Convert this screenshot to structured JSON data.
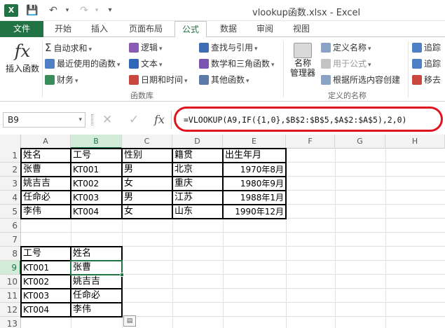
{
  "window": {
    "title": "vlookup函数.xlsx - Excel",
    "app_icon": "X",
    "qat": {
      "save": "💾",
      "undo": "↶",
      "redo": "↷",
      "customize": "▾"
    }
  },
  "tabs": [
    "文件",
    "开始",
    "插入",
    "页面布局",
    "公式",
    "数据",
    "审阅",
    "视图"
  ],
  "active_tab": "公式",
  "ribbon": {
    "insert_function": {
      "icon": "fx",
      "label": "插入函数"
    },
    "autosum": "自动求和",
    "recent": "最近使用的函数",
    "financial": "财务",
    "logical": "逻辑",
    "text": "文本",
    "datetime": "日期和时间",
    "lookup": "查找与引用",
    "math": "数学和三角函数",
    "more": "其他函数",
    "library_group": "函数库",
    "name_manager_top": "名称",
    "name_manager_bottom": "管理器",
    "define_name": "定义名称",
    "use_in_formula": "用于公式",
    "create_from_selection": "根据所选内容创建",
    "defined_names_group": "定义的名称",
    "trace_precedents": "追踪",
    "trace_dependents": "追踪",
    "remove_arrows": "移去"
  },
  "formula_bar": {
    "name_box": "B9",
    "cancel": "✕",
    "enter": "✓",
    "fx": "fx",
    "formula": "=VLOOKUP(A9,IF({1,0},$B$2:$B$5,$A$2:$A$5),2,0)"
  },
  "columns": [
    "A",
    "B",
    "C",
    "D",
    "E",
    "F",
    "G",
    "H"
  ],
  "rows": [
    "1",
    "2",
    "3",
    "4",
    "5",
    "6",
    "7",
    "8",
    "9",
    "10",
    "11",
    "12",
    "13"
  ],
  "active_cell": {
    "col": "B",
    "row": "9"
  },
  "table1": {
    "headers": [
      "姓名",
      "工号",
      "性别",
      "籍贯",
      "出生年月"
    ],
    "rows": [
      [
        "张曹",
        "KT001",
        "男",
        "北京",
        "1970年8月"
      ],
      [
        "姚吉吉",
        "KT002",
        "女",
        "重庆",
        "1980年9月"
      ],
      [
        "任命必",
        "KT003",
        "男",
        "江苏",
        "1988年1月"
      ],
      [
        "李伟",
        "KT004",
        "女",
        "山东",
        "1990年12月"
      ]
    ]
  },
  "table2": {
    "headers": [
      "工号",
      "姓名"
    ],
    "rows": [
      [
        "KT001",
        "张曹"
      ],
      [
        "KT002",
        "姚吉吉"
      ],
      [
        "KT003",
        "任命必"
      ],
      [
        "KT004",
        "李伟"
      ]
    ]
  },
  "colors": {
    "excel_green": "#217346",
    "highlight_red": "#e0141e"
  }
}
